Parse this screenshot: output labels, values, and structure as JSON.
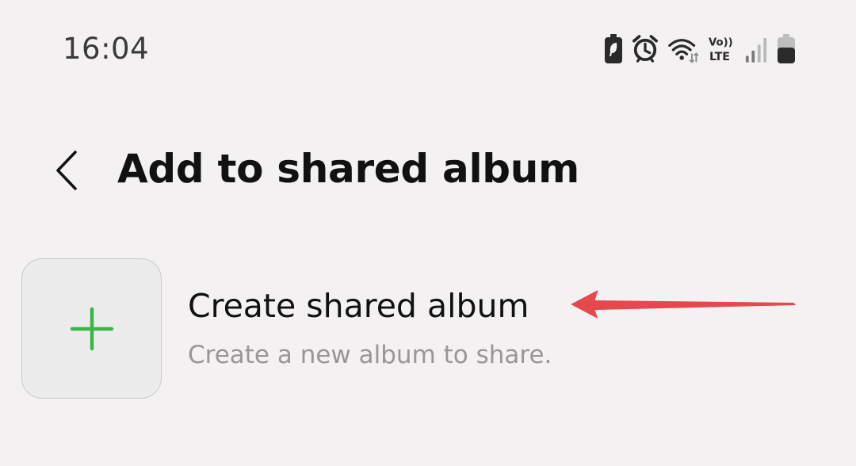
{
  "status_bar": {
    "time": "16:04",
    "icons": [
      "battery-saver-icon",
      "alarm-icon",
      "wifi-icon",
      "volte-icon",
      "signal-icon",
      "battery-icon"
    ],
    "volte_text": "Vo))",
    "lte_text": "LTE"
  },
  "header": {
    "back_icon": "chevron-left-icon",
    "title": "Add to shared album"
  },
  "create_item": {
    "icon": "plus-icon",
    "title": "Create shared album",
    "subtitle": "Create a new album to share."
  },
  "colors": {
    "background": "#f3f1f2",
    "plus": "#3bb54a",
    "subtitle": "#9a9597",
    "arrow": "#e5484d"
  }
}
